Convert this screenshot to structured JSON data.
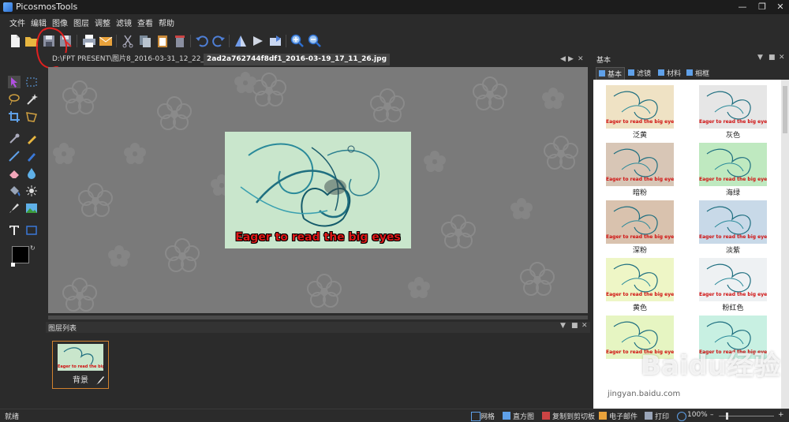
{
  "app": {
    "title": "PicosmosTools"
  },
  "menu": [
    "文件",
    "编辑",
    "图像",
    "图层",
    "调整",
    "滤镜",
    "查看",
    "帮助"
  ],
  "doc_tabs": [
    {
      "label": "D:\\FPT PRESENT\\图片8_2016-03-31_12_22_28.png",
      "active": false
    },
    {
      "label": "2ad2a762744f8df1_2016-03-19_17_11_26.jpg",
      "active": true
    }
  ],
  "canvas": {
    "image_text": "Eager to read the big eyes"
  },
  "layers": {
    "title": "图层列表",
    "layer_name": "背景"
  },
  "right_panel": {
    "title": "基本",
    "tabs": [
      "基本",
      "滤镜",
      "材料",
      "相框"
    ],
    "preset_text": "Eager to read the big eyes",
    "presets": [
      {
        "label": "泛黄",
        "tint": "#efe2c4"
      },
      {
        "label": "灰色",
        "tint": "#e6e6e6"
      },
      {
        "label": "暗粉",
        "tint": "#d8c6b6"
      },
      {
        "label": "海绿",
        "tint": "#bfe9c0"
      },
      {
        "label": "深粉",
        "tint": "#d9c2ae"
      },
      {
        "label": "淡紫",
        "tint": "#c8d9e8"
      },
      {
        "label": "黄色",
        "tint": "#eef6c6"
      },
      {
        "label": "粉红色",
        "tint": "#eef1f3"
      },
      {
        "label": "",
        "tint": "#e6f5c2"
      },
      {
        "label": "",
        "tint": "#c8f0e2"
      }
    ]
  },
  "watermark": {
    "text": "Baidu经验",
    "url": "jingyan.baidu.com"
  },
  "status": {
    "left": "就绪",
    "grid": "网格",
    "histogram": "直方图",
    "copy": "复制到剪切板",
    "email": "电子邮件",
    "print": "打印",
    "zoom": "100%"
  },
  "colors": {
    "accent": "#d0812e",
    "annotation": "#e0201f"
  }
}
